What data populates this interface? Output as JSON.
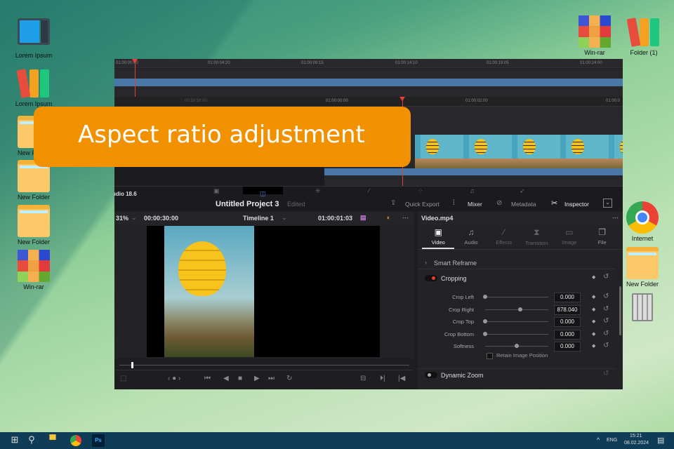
{
  "desktop": {
    "icons_left": [
      {
        "label": "Lorem Ipsum",
        "icon": "computer-icon"
      },
      {
        "label": "Lorem Ipsum",
        "icon": "binders-icon"
      },
      {
        "label": "New Folder",
        "icon": "folder-icon"
      },
      {
        "label": "New Folder",
        "icon": "folder-icon"
      },
      {
        "label": "New Folder",
        "icon": "folder-icon"
      },
      {
        "label": "Win-rar",
        "icon": "winrar-icon"
      }
    ],
    "icons_right": [
      {
        "label": "Win-rar",
        "icon": "winrar-icon"
      },
      {
        "label": "Folder (1)",
        "icon": "binders-icon"
      },
      {
        "label": "Internet",
        "icon": "chrome-icon"
      },
      {
        "label": "New Folder",
        "icon": "folder-icon"
      },
      {
        "label": "",
        "icon": "recycle-bin-icon"
      }
    ]
  },
  "banner": {
    "text": "Aspect ratio adjustment",
    "color": "#f29100"
  },
  "timeline_top": {
    "ticks": [
      "01:00:00:00",
      "01:00:04:20",
      "01:00:09:15",
      "01:00:14:10",
      "01:00:19:05",
      "01:00:24:00"
    ]
  },
  "timeline_bottom": {
    "ticks": [
      "00:59:58:00",
      "01:00:00:00",
      "01:00:02:00",
      "01:00:0"
    ]
  },
  "app": {
    "version": "udio 18.6",
    "project_title": "Untitled Project 3",
    "project_status": "Edited",
    "toolbar": {
      "quick_export": "Quick Export",
      "mixer": "Mixer",
      "metadata": "Metadata",
      "inspector": "Inspector"
    }
  },
  "viewer": {
    "zoom": "31%",
    "duration": "00:00:30:00",
    "timeline_name": "Timeline 1",
    "timecode": "01:00:01:03",
    "scrub_position": 0.04
  },
  "inspector": {
    "clip_name": "Video.mp4",
    "tabs": [
      "Video",
      "Audio",
      "Effects",
      "Transition",
      "Image",
      "File"
    ],
    "active_tab": "Video",
    "smart_reframe": "Smart Reframe",
    "cropping": {
      "title": "Cropping",
      "enabled": true,
      "params": [
        {
          "label": "Crop Left",
          "value": "0.000",
          "slider": 0
        },
        {
          "label": "Crop Right",
          "value": "878.040",
          "slider": 0.55
        },
        {
          "label": "Crop Top",
          "value": "0.000",
          "slider": 0
        },
        {
          "label": "Crop Bottom",
          "value": "0.000",
          "slider": 0
        },
        {
          "label": "Softness",
          "value": "0.000",
          "slider": 0.5
        }
      ],
      "retain_label": "Retain Image Position"
    },
    "dynamic_zoom": "Dynamic Zoom"
  },
  "taskbar": {
    "lang": "ENG",
    "time": "15:21",
    "date": "08.02.2024"
  }
}
